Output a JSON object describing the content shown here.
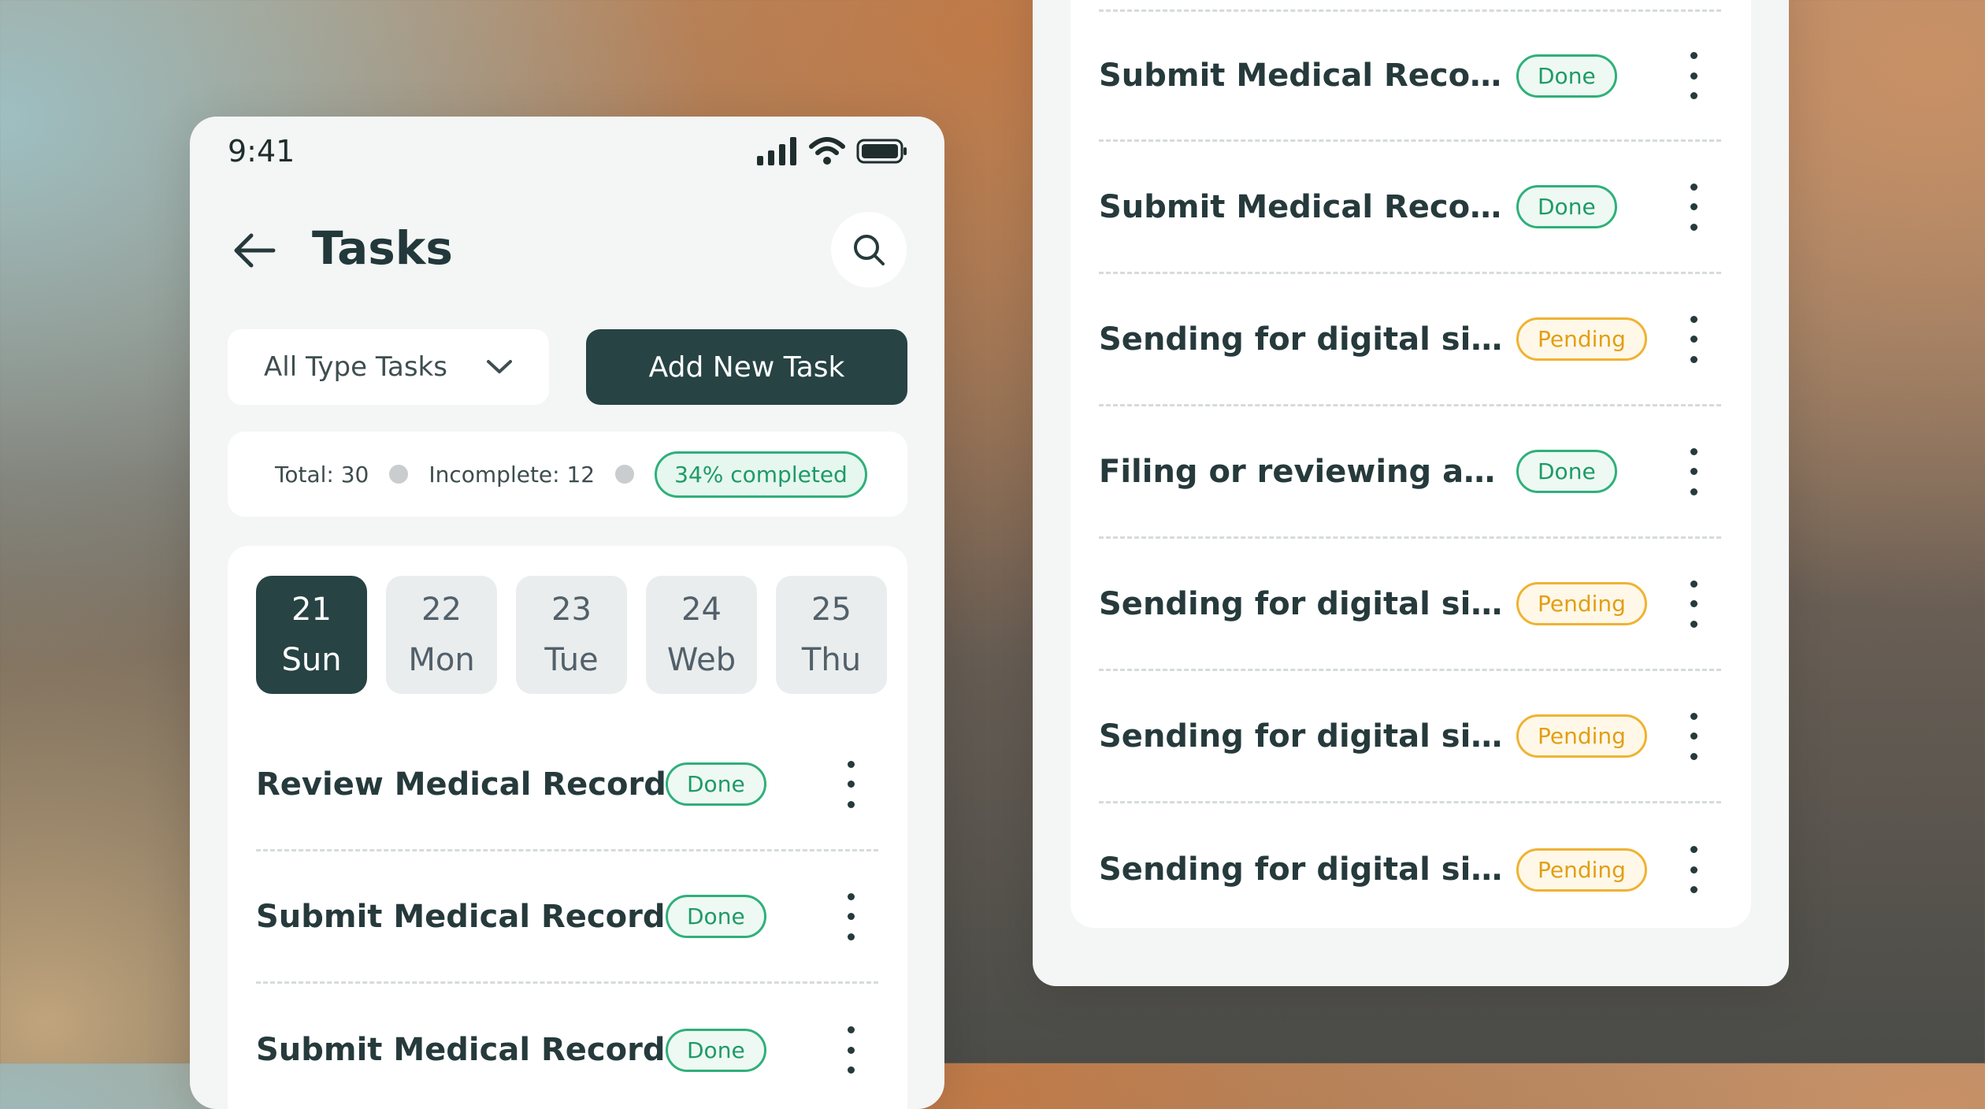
{
  "status_bar": {
    "time": "9:41"
  },
  "header": {
    "title": "Tasks"
  },
  "filter": {
    "label": "All Type Tasks"
  },
  "add_button": {
    "label": "Add New Task"
  },
  "summary": {
    "total": "Total: 30",
    "incomplete": "Incomplete: 12",
    "completed": "34% completed"
  },
  "days": [
    {
      "num": "21",
      "name": "Sun",
      "active": true
    },
    {
      "num": "22",
      "name": "Mon",
      "active": false
    },
    {
      "num": "23",
      "name": "Tue",
      "active": false
    },
    {
      "num": "24",
      "name": "Web",
      "active": false
    },
    {
      "num": "25",
      "name": "Thu",
      "active": false
    }
  ],
  "left_tasks": [
    {
      "title": "Review Medical Records",
      "status": "Done"
    },
    {
      "title": "Submit Medical Records",
      "status": "Done"
    },
    {
      "title": "Submit Medical Records",
      "status": "Done"
    }
  ],
  "right_tasks": [
    {
      "title": "Submit Medical Records",
      "status": "Done"
    },
    {
      "title": "Submit Medical Records",
      "status": "Done"
    },
    {
      "title": "Sending for digital signa...",
      "status": "Pending"
    },
    {
      "title": "Filing or reviewing appe...",
      "status": "Done"
    },
    {
      "title": "Sending for digital signa...",
      "status": "Pending"
    },
    {
      "title": "Sending for digital signa...",
      "status": "Pending"
    },
    {
      "title": "Sending for digital signa...",
      "status": "Pending"
    }
  ],
  "icons": {
    "back": "arrow-left-icon",
    "search": "search-icon",
    "chevron": "chevron-down-icon",
    "signal": "signal-icon",
    "wifi": "wifi-icon",
    "battery": "battery-icon",
    "more": "more-vertical-icon"
  },
  "colors": {
    "primary": "#274344",
    "done": "#2fb07a",
    "pending": "#f0b233"
  }
}
